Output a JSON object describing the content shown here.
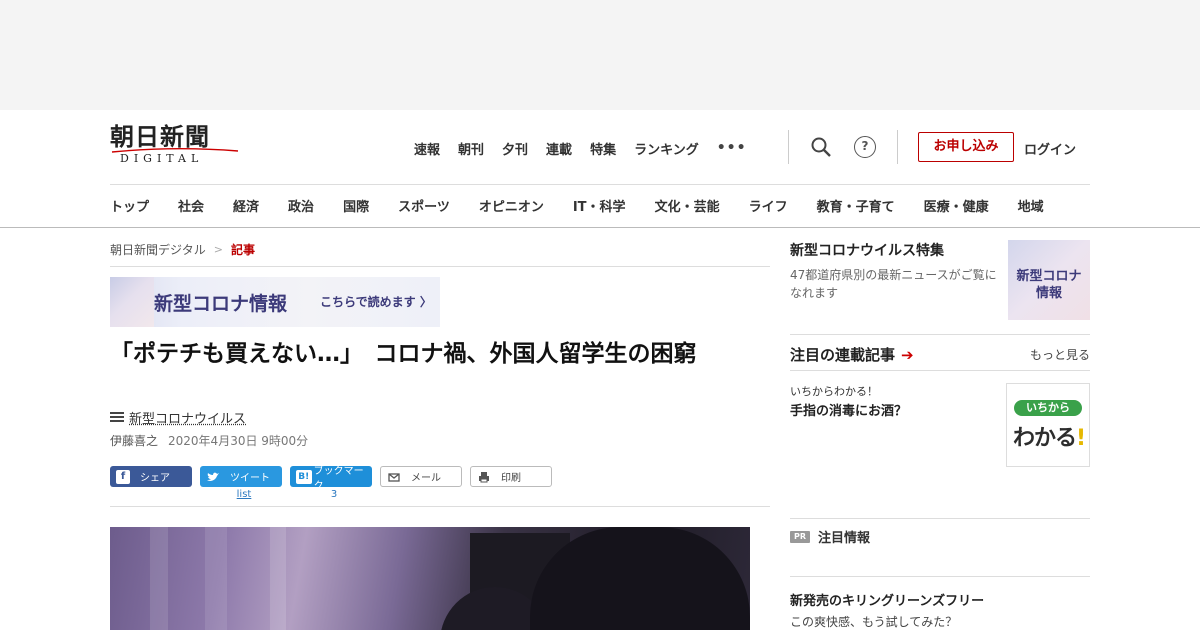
{
  "logo": {
    "name": "朝日新聞",
    "sub": "DIGITAL"
  },
  "top_nav": [
    "速報",
    "朝刊",
    "夕刊",
    "連載",
    "特集",
    "ランキング"
  ],
  "more_label": "•••",
  "help_label": "?",
  "subscribe_label": "お申し込み",
  "login_label": "ログイン",
  "category_nav": [
    "トップ",
    "社会",
    "経済",
    "政治",
    "国際",
    "スポーツ",
    "オピニオン",
    "IT・科学",
    "文化・芸能",
    "ライフ",
    "教育・子育て",
    "医療・健康",
    "地域"
  ],
  "breadcrumb": {
    "home": "朝日新聞デジタル",
    "sep": ">",
    "current": "記事"
  },
  "banner": {
    "title": "新型コロナ情報",
    "cta": "こちらで読めます 〉"
  },
  "article": {
    "title": "「ポテチも買えない…」　コロナ禍、外国人留学生の困窮",
    "tag": "新型コロナウイルス",
    "author": "伊藤喜之",
    "date": "2020年4月30日 9時00分"
  },
  "share": {
    "facebook": "シェア",
    "twitter": "ツイート",
    "hatena": "ブックマーク",
    "hatena_glyph": "B!",
    "mail": "メール",
    "print": "印刷",
    "twitter_count": "list",
    "hatena_count": "3"
  },
  "sidebar": {
    "feature": {
      "title": "新型コロナウイルス特集",
      "desc": "47都道府県別の最新ニュースがご覧になれます",
      "thumb_text": "新型コロナ情報"
    },
    "series_section": {
      "title": "注目の連載記事",
      "more": "もっと見る"
    },
    "series": {
      "kicker": "いちからわかる！",
      "title": "手指の消毒にお酒？",
      "thumb_pill": "いちから",
      "thumb_big": "わかる",
      "thumb_bang": "!"
    },
    "pr": {
      "badge": "PR",
      "label": "注目情報"
    },
    "promo": {
      "title": "新発売のキリングリーンズフリー",
      "desc": "この爽快感、もう試してみた？"
    }
  },
  "colors": {
    "brand_red": "#b00000",
    "facebook": "#3b5998",
    "twitter": "#2a98e0",
    "hatena": "#1e8fd9",
    "corona_purple": "#3c3a7a"
  },
  "icons": [
    "search-icon",
    "help-icon",
    "more-icon",
    "list-icon",
    "facebook-icon",
    "twitter-icon",
    "hatena-icon",
    "mail-icon",
    "print-icon",
    "arrow-right-icon"
  ]
}
